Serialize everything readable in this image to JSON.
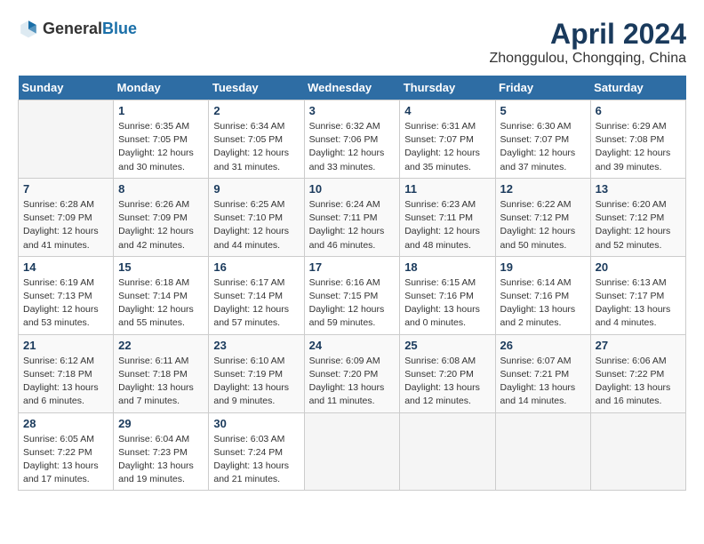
{
  "header": {
    "logo_general": "General",
    "logo_blue": "Blue",
    "title": "April 2024",
    "subtitle": "Zhonggulou, Chongqing, China"
  },
  "days_of_week": [
    "Sunday",
    "Monday",
    "Tuesday",
    "Wednesday",
    "Thursday",
    "Friday",
    "Saturday"
  ],
  "weeks": [
    [
      {
        "day": "",
        "info": ""
      },
      {
        "day": "1",
        "info": "Sunrise: 6:35 AM\nSunset: 7:05 PM\nDaylight: 12 hours\nand 30 minutes."
      },
      {
        "day": "2",
        "info": "Sunrise: 6:34 AM\nSunset: 7:05 PM\nDaylight: 12 hours\nand 31 minutes."
      },
      {
        "day": "3",
        "info": "Sunrise: 6:32 AM\nSunset: 7:06 PM\nDaylight: 12 hours\nand 33 minutes."
      },
      {
        "day": "4",
        "info": "Sunrise: 6:31 AM\nSunset: 7:07 PM\nDaylight: 12 hours\nand 35 minutes."
      },
      {
        "day": "5",
        "info": "Sunrise: 6:30 AM\nSunset: 7:07 PM\nDaylight: 12 hours\nand 37 minutes."
      },
      {
        "day": "6",
        "info": "Sunrise: 6:29 AM\nSunset: 7:08 PM\nDaylight: 12 hours\nand 39 minutes."
      }
    ],
    [
      {
        "day": "7",
        "info": "Sunrise: 6:28 AM\nSunset: 7:09 PM\nDaylight: 12 hours\nand 41 minutes."
      },
      {
        "day": "8",
        "info": "Sunrise: 6:26 AM\nSunset: 7:09 PM\nDaylight: 12 hours\nand 42 minutes."
      },
      {
        "day": "9",
        "info": "Sunrise: 6:25 AM\nSunset: 7:10 PM\nDaylight: 12 hours\nand 44 minutes."
      },
      {
        "day": "10",
        "info": "Sunrise: 6:24 AM\nSunset: 7:11 PM\nDaylight: 12 hours\nand 46 minutes."
      },
      {
        "day": "11",
        "info": "Sunrise: 6:23 AM\nSunset: 7:11 PM\nDaylight: 12 hours\nand 48 minutes."
      },
      {
        "day": "12",
        "info": "Sunrise: 6:22 AM\nSunset: 7:12 PM\nDaylight: 12 hours\nand 50 minutes."
      },
      {
        "day": "13",
        "info": "Sunrise: 6:20 AM\nSunset: 7:12 PM\nDaylight: 12 hours\nand 52 minutes."
      }
    ],
    [
      {
        "day": "14",
        "info": "Sunrise: 6:19 AM\nSunset: 7:13 PM\nDaylight: 12 hours\nand 53 minutes."
      },
      {
        "day": "15",
        "info": "Sunrise: 6:18 AM\nSunset: 7:14 PM\nDaylight: 12 hours\nand 55 minutes."
      },
      {
        "day": "16",
        "info": "Sunrise: 6:17 AM\nSunset: 7:14 PM\nDaylight: 12 hours\nand 57 minutes."
      },
      {
        "day": "17",
        "info": "Sunrise: 6:16 AM\nSunset: 7:15 PM\nDaylight: 12 hours\nand 59 minutes."
      },
      {
        "day": "18",
        "info": "Sunrise: 6:15 AM\nSunset: 7:16 PM\nDaylight: 13 hours\nand 0 minutes."
      },
      {
        "day": "19",
        "info": "Sunrise: 6:14 AM\nSunset: 7:16 PM\nDaylight: 13 hours\nand 2 minutes."
      },
      {
        "day": "20",
        "info": "Sunrise: 6:13 AM\nSunset: 7:17 PM\nDaylight: 13 hours\nand 4 minutes."
      }
    ],
    [
      {
        "day": "21",
        "info": "Sunrise: 6:12 AM\nSunset: 7:18 PM\nDaylight: 13 hours\nand 6 minutes."
      },
      {
        "day": "22",
        "info": "Sunrise: 6:11 AM\nSunset: 7:18 PM\nDaylight: 13 hours\nand 7 minutes."
      },
      {
        "day": "23",
        "info": "Sunrise: 6:10 AM\nSunset: 7:19 PM\nDaylight: 13 hours\nand 9 minutes."
      },
      {
        "day": "24",
        "info": "Sunrise: 6:09 AM\nSunset: 7:20 PM\nDaylight: 13 hours\nand 11 minutes."
      },
      {
        "day": "25",
        "info": "Sunrise: 6:08 AM\nSunset: 7:20 PM\nDaylight: 13 hours\nand 12 minutes."
      },
      {
        "day": "26",
        "info": "Sunrise: 6:07 AM\nSunset: 7:21 PM\nDaylight: 13 hours\nand 14 minutes."
      },
      {
        "day": "27",
        "info": "Sunrise: 6:06 AM\nSunset: 7:22 PM\nDaylight: 13 hours\nand 16 minutes."
      }
    ],
    [
      {
        "day": "28",
        "info": "Sunrise: 6:05 AM\nSunset: 7:22 PM\nDaylight: 13 hours\nand 17 minutes."
      },
      {
        "day": "29",
        "info": "Sunrise: 6:04 AM\nSunset: 7:23 PM\nDaylight: 13 hours\nand 19 minutes."
      },
      {
        "day": "30",
        "info": "Sunrise: 6:03 AM\nSunset: 7:24 PM\nDaylight: 13 hours\nand 21 minutes."
      },
      {
        "day": "",
        "info": ""
      },
      {
        "day": "",
        "info": ""
      },
      {
        "day": "",
        "info": ""
      },
      {
        "day": "",
        "info": ""
      }
    ]
  ]
}
